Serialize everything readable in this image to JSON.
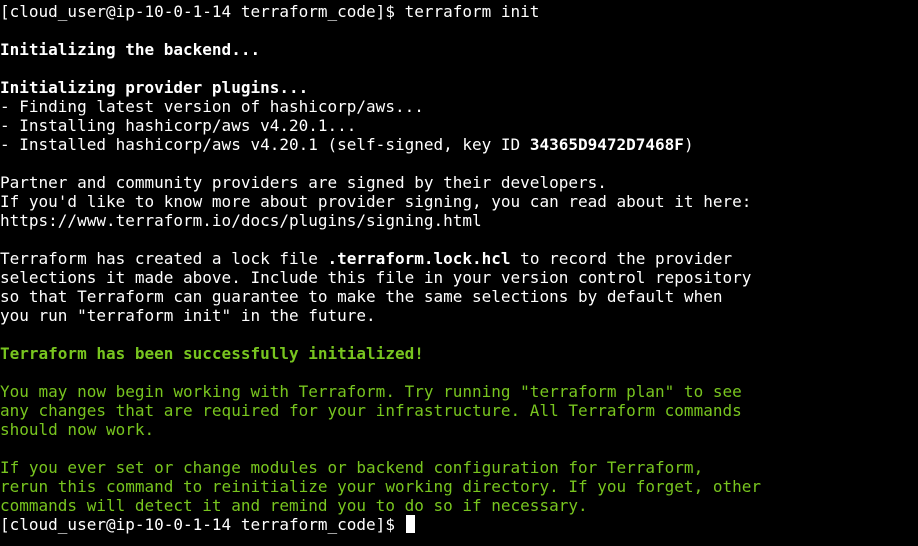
{
  "terminal": {
    "prompt": "[cloud_user@ip-10-0-1-14 terraform_code]$ ",
    "command": "terraform init",
    "init_backend": "Initializing the backend...",
    "init_plugins": "Initializing provider plugins...",
    "finding": "- Finding latest version of hashicorp/aws...",
    "installing": "- Installing hashicorp/aws v4.20.1...",
    "installed_prefix": "- Installed hashicorp/aws v4.20.1 (self-signed, key ID ",
    "key_id": "34365D9472D7468F",
    "installed_suffix": ")",
    "partner_1": "Partner and community providers are signed by their developers.",
    "partner_2": "If you'd like to know more about provider signing, you can read about it here:",
    "partner_url": "https://www.terraform.io/docs/plugins/signing.html",
    "lock_1_prefix": "Terraform has created a lock file ",
    "lock_file": ".terraform.lock.hcl",
    "lock_1_suffix": " to record the provider",
    "lock_2": "selections it made above. Include this file in your version control repository",
    "lock_3": "so that Terraform can guarantee to make the same selections by default when",
    "lock_4": "you run \"terraform init\" in the future.",
    "success": "Terraform has been successfully initialized!",
    "begin_1": "You may now begin working with Terraform. Try running \"terraform plan\" to see",
    "begin_2": "any changes that are required for your infrastructure. All Terraform commands",
    "begin_3": "should now work.",
    "modules_1": "If you ever set or change modules or backend configuration for Terraform,",
    "modules_2": "rerun this command to reinitialize your working directory. If you forget, other",
    "modules_3": "commands will detect it and remind you to do so if necessary."
  },
  "colors": {
    "background": "#000000",
    "foreground": "#ffffff",
    "success_green": "#78c51f"
  }
}
